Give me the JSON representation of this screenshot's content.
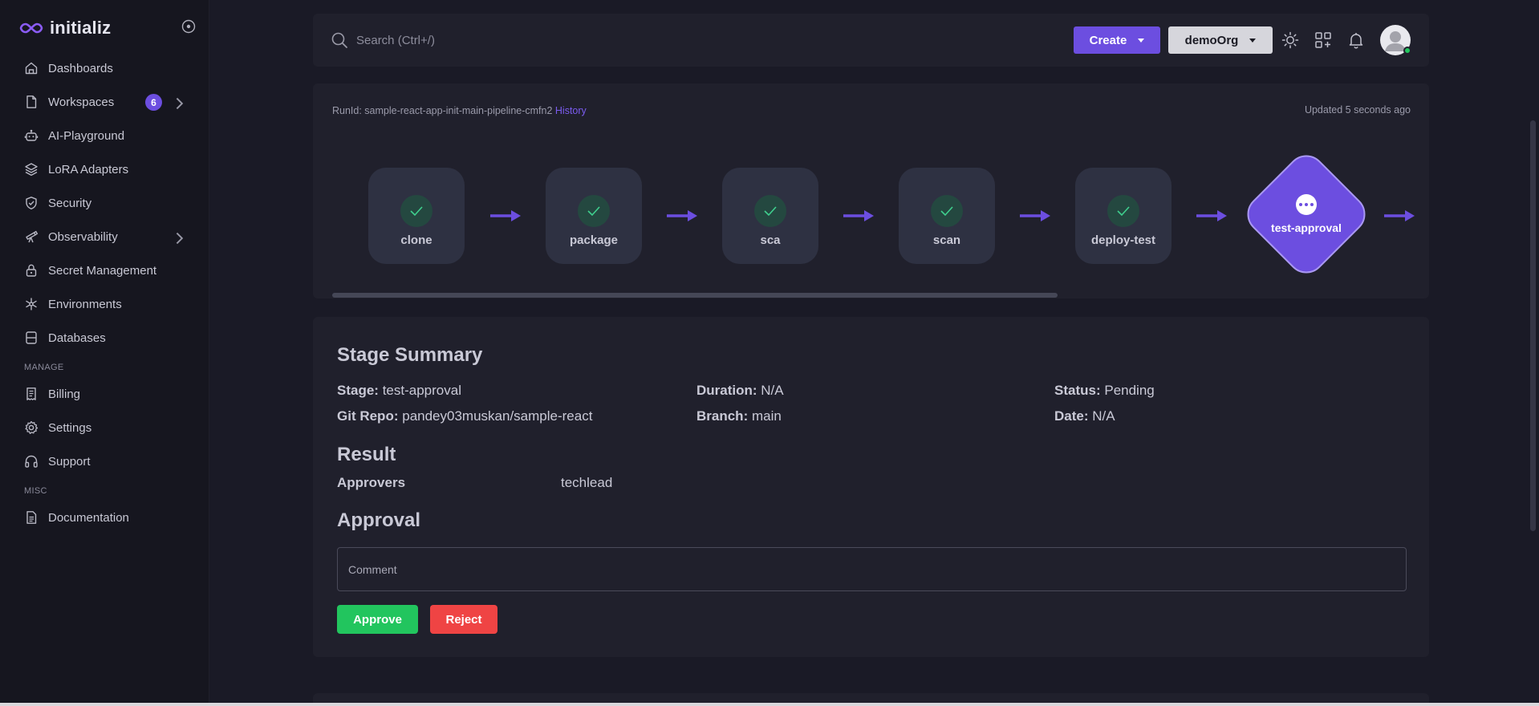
{
  "app": {
    "name": "initializ"
  },
  "sidebar": {
    "items": [
      {
        "label": "Dashboards",
        "icon": "home-icon"
      },
      {
        "label": "Workspaces",
        "icon": "file-icon",
        "badge": "6",
        "expandable": true
      },
      {
        "label": "AI-Playground",
        "icon": "robot-icon"
      },
      {
        "label": "LoRA Adapters",
        "icon": "layers-icon"
      },
      {
        "label": "Security",
        "icon": "shield-icon"
      },
      {
        "label": "Observability",
        "icon": "telescope-icon",
        "expandable": true
      },
      {
        "label": "Secret Management",
        "icon": "lock-icon"
      },
      {
        "label": "Environments",
        "icon": "snowflake-icon"
      },
      {
        "label": "Databases",
        "icon": "database-icon"
      }
    ],
    "manage_label": "MANAGE",
    "manage_items": [
      {
        "label": "Billing",
        "icon": "receipt-icon"
      },
      {
        "label": "Settings",
        "icon": "gear-icon"
      },
      {
        "label": "Support",
        "icon": "headphones-icon"
      }
    ],
    "misc_label": "MISC",
    "misc_items": [
      {
        "label": "Documentation",
        "icon": "document-icon"
      }
    ]
  },
  "header": {
    "search_placeholder": "Search (Ctrl+/)",
    "create_label": "Create",
    "org_label": "demoOrg",
    "online_status_color": "#22c55e"
  },
  "pipeline": {
    "run_prefix": "RunId: sample-react-app-init-main-pipeline-cmfn2",
    "history_label": "History",
    "updated": "Updated 5 seconds ago",
    "stages": [
      {
        "name": "clone",
        "status": "success"
      },
      {
        "name": "package",
        "status": "success"
      },
      {
        "name": "sca",
        "status": "success"
      },
      {
        "name": "scan",
        "status": "success"
      },
      {
        "name": "deploy-test",
        "status": "success"
      },
      {
        "name": "test-approval",
        "status": "pending"
      }
    ]
  },
  "summary": {
    "title": "Stage Summary",
    "stage_label": "Stage:",
    "stage_value": "test-approval",
    "duration_label": "Duration:",
    "duration_value": "N/A",
    "status_label": "Status:",
    "status_value": "Pending",
    "repo_label": "Git Repo:",
    "repo_value": "pandey03muskan/sample-react",
    "branch_label": "Branch:",
    "branch_value": "main",
    "date_label": "Date:",
    "date_value": "N/A",
    "result_title": "Result",
    "approvers_label": "Approvers",
    "approvers_value": "techlead",
    "approval_title": "Approval",
    "comment_placeholder": "Comment",
    "approve_label": "Approve",
    "reject_label": "Reject"
  },
  "colors": {
    "accent": "#6c4ee0",
    "success": "#22c55e",
    "danger": "#ef4444",
    "panel": "#20202c",
    "background": "#1a1a26"
  }
}
